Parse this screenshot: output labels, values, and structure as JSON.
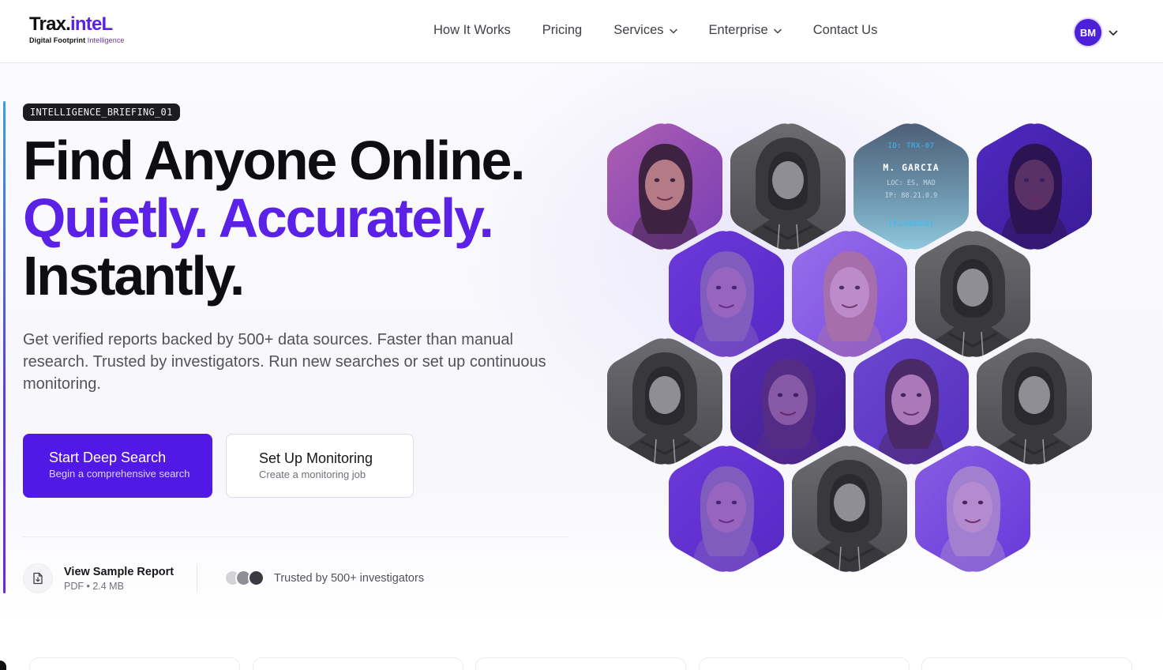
{
  "brand": {
    "name_part1": "Trax.",
    "name_part2": "inteL",
    "tagline_part1": "Digital Footprint ",
    "tagline_part2": "Intelligence",
    "accent_color": "#5b21e6"
  },
  "nav": {
    "links": [
      {
        "label": "How It Works",
        "has_dropdown": false
      },
      {
        "label": "Pricing",
        "has_dropdown": false
      },
      {
        "label": "Services",
        "has_dropdown": true
      },
      {
        "label": "Enterprise",
        "has_dropdown": true
      },
      {
        "label": "Contact Us",
        "has_dropdown": false
      }
    ],
    "user_initials": "BM"
  },
  "hero": {
    "tag": "INTELLIGENCE_BRIEFING_01",
    "headline_line1": "Find Anyone Online.",
    "headline_line2": "Quietly. Accurately.",
    "headline_line3": "Instantly.",
    "description": "Get verified reports backed by 500+ data sources. Faster than manual research. Trusted by investigators. Run new searches or set up continuous monitoring.",
    "primary_cta": {
      "title": "Start Deep Search",
      "subtitle": "Begin a comprehensive search"
    },
    "secondary_cta": {
      "title": "Set Up Monitoring",
      "subtitle": "Create a monitoring job"
    },
    "sample_report": {
      "title": "View Sample Report",
      "meta": "PDF • 2.4 MB"
    },
    "trusted_text": "Trusted by 500+ investigators"
  },
  "profile_card": {
    "id": "ID: TRX-07",
    "name": "M. GARCIA",
    "location": "LOC: ES, MAD",
    "ip": "IP: 88.21.0.9",
    "status": "[FLAGGED]"
  },
  "hex_tiles": [
    "face-photo",
    "anonymous-hoodie",
    "data-card",
    "face-photo",
    "face-photo",
    "face-photo",
    "anonymous-hoodie",
    "anonymous-hoodie",
    "face-photo",
    "face-photo",
    "anonymous-hoodie",
    "face-photo",
    "anonymous-hoodie",
    "face-photo"
  ]
}
